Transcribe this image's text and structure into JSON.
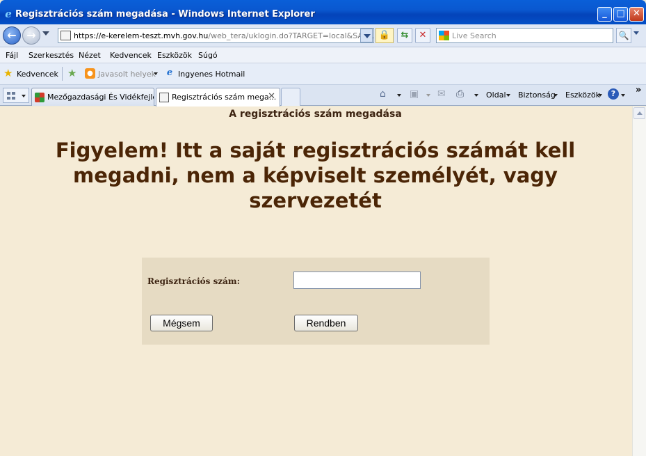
{
  "window": {
    "title": "Regisztrációs szám megadása - Windows Internet Explorer",
    "controls": [
      "minimize",
      "maximize",
      "close"
    ]
  },
  "address_bar": {
    "url_main": "https://e-kerelem-teszt.mvh.gov.hu",
    "url_path": "/web_tera/uklogin.do?TARGET=local&SAMLart=Ic",
    "search_placeholder": "Live Search"
  },
  "menu": {
    "items": [
      "Fájl",
      "Szerkesztés",
      "Nézet",
      "Kedvencek",
      "Eszközök",
      "Súgó"
    ]
  },
  "favorites": {
    "label": "Kedvencek",
    "suggested": "Javasolt helyek",
    "hotmail": "Ingyenes Hotmail"
  },
  "tabs": [
    {
      "label": "Mezőgazdasági És Vidékfejle..."
    },
    {
      "label": "Regisztrációs szám mega...",
      "active": true
    }
  ],
  "commands": {
    "page": "Oldal",
    "security": "Biztonság",
    "tools": "Eszközök",
    "overflow": "»"
  },
  "page": {
    "heading": "A regisztrációs szám megadása",
    "warning": "Figyelem! Itt a saját regisztrációs számát kell megadni, nem a képviselt személyét, vagy szervezetét",
    "form": {
      "reg_label": "Regisztrációs szám:",
      "reg_value": "",
      "cancel_button": "Mégsem",
      "ok_button": "Rendben"
    }
  },
  "colors": {
    "page_background": "#f5ebd6",
    "panel_background": "#e6dbc3",
    "heading_text": "#4b2506"
  }
}
